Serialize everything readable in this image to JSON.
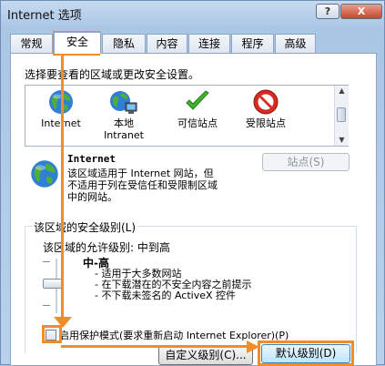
{
  "window": {
    "title": "Internet 选项",
    "help_label": "?",
    "close_label": "X"
  },
  "tabs": [
    {
      "label": "常规"
    },
    {
      "label": "安全"
    },
    {
      "label": "隐私"
    },
    {
      "label": "内容"
    },
    {
      "label": "连接"
    },
    {
      "label": "程序"
    },
    {
      "label": "高级"
    }
  ],
  "active_tab": "安全",
  "security": {
    "select_prompt": "选择要查看的区域或更改安全设置。",
    "zones": [
      {
        "label": "Internet",
        "icon": "globe-icon"
      },
      {
        "label": "本地\nIntranet",
        "icon": "intranet-icon"
      },
      {
        "label": "可信站点",
        "icon": "checkmark-icon"
      },
      {
        "label": "受限站点",
        "icon": "no-entry-icon"
      }
    ],
    "selected_zone": {
      "title": "Internet",
      "description": [
        "该区域适用于 Internet 网站，但",
        "不适用于列在受信任和受限制区域",
        "中的网站。"
      ]
    },
    "sites_button": "站点(S)",
    "level_group_label": "该区域的安全级别(L)",
    "allowed_levels": "该区域的允许级别: 中到高",
    "level_name": "中-高",
    "level_bullets": [
      "- 适用于大多数网站",
      "- 在下载潜在的不安全内容之前提示",
      "- 不下载未签名的 ActiveX 控件"
    ],
    "protected_mode": "启用保护模式(要求重新启动 Internet Explorer)(P)",
    "protected_mode_checked": false,
    "custom_level_button": "自定义级别(C)...",
    "default_level_button": "默认级别(D)"
  },
  "colors": {
    "annotation": "#f08c2a",
    "title_gradient_top": "#c7daf0"
  }
}
